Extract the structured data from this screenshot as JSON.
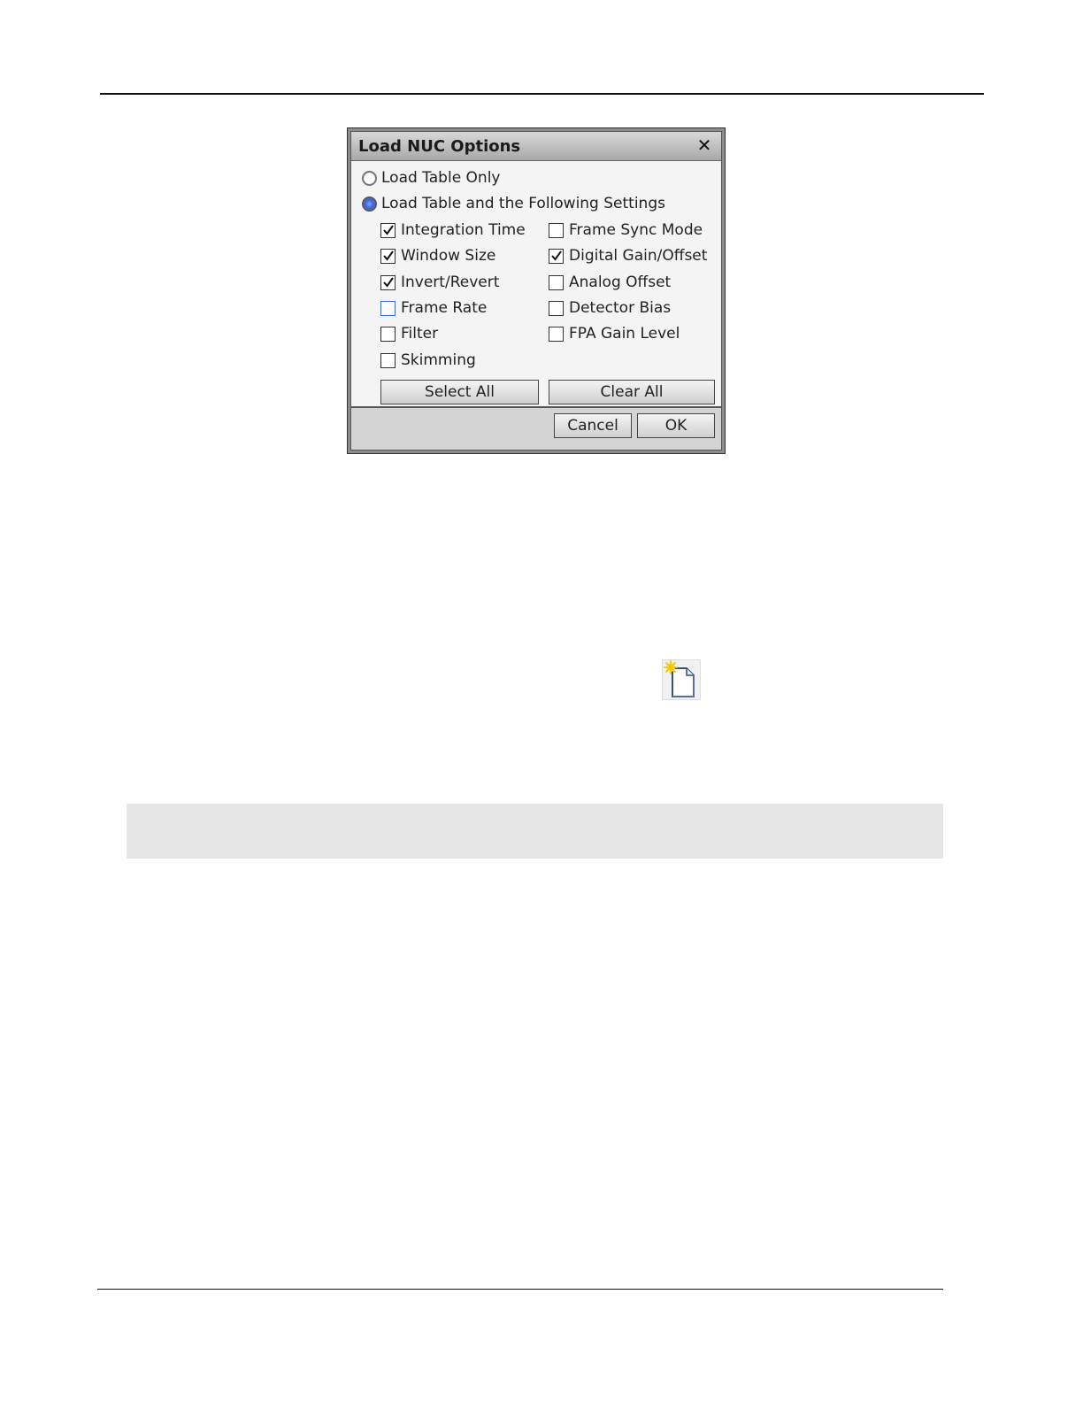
{
  "dialog": {
    "title": "Load NUC Options",
    "close_symbol": "✕",
    "radios": [
      {
        "label": "Load Table Only",
        "selected": false
      },
      {
        "label": "Load Table and the Following Settings",
        "selected": true
      }
    ],
    "checkboxes_left": [
      {
        "label": "Integration Time",
        "checked": true
      },
      {
        "label": "Window Size",
        "checked": true
      },
      {
        "label": "Invert/Revert",
        "checked": true
      },
      {
        "label": "Frame Rate",
        "checked": false
      },
      {
        "label": "Filter",
        "checked": false
      },
      {
        "label": "Skimming",
        "checked": false
      }
    ],
    "checkboxes_right": [
      {
        "label": "Frame Sync Mode",
        "checked": false
      },
      {
        "label": "Digital Gain/Offset",
        "checked": true
      },
      {
        "label": "Analog Offset",
        "checked": false
      },
      {
        "label": "Detector Bias",
        "checked": false
      },
      {
        "label": "FPA Gain Level",
        "checked": false
      }
    ],
    "select_all_label": "Select All",
    "clear_all_label": "Clear All",
    "cancel_label": "Cancel",
    "ok_label": "OK"
  },
  "icons": {
    "new_document": "new-document-icon"
  }
}
